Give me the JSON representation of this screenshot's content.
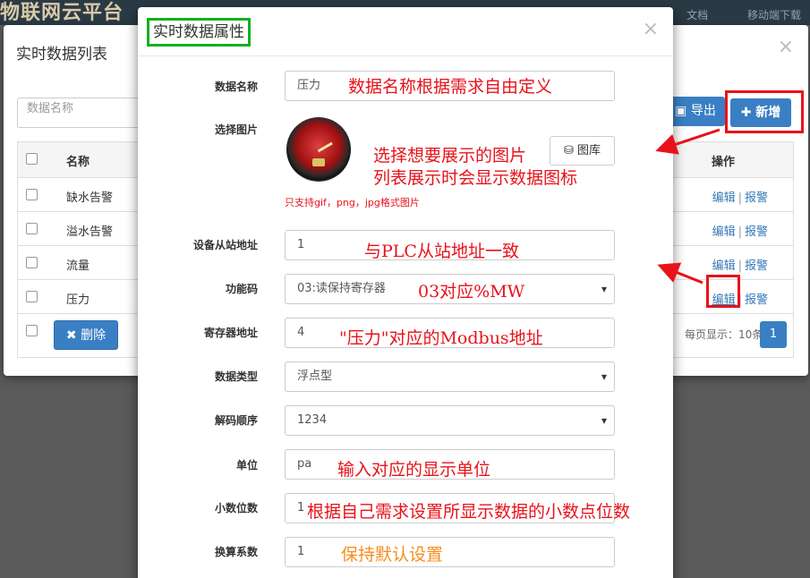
{
  "topbar": {
    "brand": "物联网云平台",
    "link_docs": "文档",
    "link_mobile": "移动端下载"
  },
  "list_modal": {
    "title": "实时数据列表",
    "close": "×",
    "search_placeholder": "数据名称",
    "export_label": "导出",
    "new_label": "新增",
    "columns": {
      "name": "名称",
      "ops": "操作"
    },
    "rows": [
      {
        "name": "缺水告警",
        "edit": "编辑",
        "alarm": "报警"
      },
      {
        "name": "溢水告警",
        "edit": "编辑",
        "alarm": "报警"
      },
      {
        "name": "流量",
        "edit": "编辑",
        "alarm": "报警"
      },
      {
        "name": "压力",
        "edit": "编辑",
        "alarm": "报警"
      }
    ],
    "delete_label": "删除",
    "pager_text": "每页显示：10条",
    "page_num": "1"
  },
  "form_modal": {
    "title": "实时数据属性",
    "close": "×",
    "fields": {
      "name": {
        "label": "数据名称",
        "value": "压力",
        "annotation": "数据名称根据需求自由定义"
      },
      "image": {
        "label": "选择图片",
        "gallery": "图库",
        "hint": "只支持gif，png，jpg格式图片",
        "annotation_1": "选择想要展示的图片",
        "annotation_2": "列表展示时会显示数据图标"
      },
      "slave": {
        "label": "设备从站地址",
        "value": "1",
        "annotation": "与PLC从站地址一致"
      },
      "func": {
        "label": "功能码",
        "value": "03:读保持寄存器",
        "annotation": "03对应%MW"
      },
      "reg": {
        "label": "寄存器地址",
        "value": "4",
        "annotation": "\"压力\"对应的Modbus地址"
      },
      "dtype": {
        "label": "数据类型",
        "value": "浮点型"
      },
      "order": {
        "label": "解码顺序",
        "value": "1234"
      },
      "unit": {
        "label": "单位",
        "value": "pa",
        "annotation": "输入对应的显示单位"
      },
      "decimals": {
        "label": "小数位数",
        "value": "1",
        "annotation": "根据自己需求设置所显示数据的小数点位数"
      },
      "factor": {
        "label": "换算系数",
        "value": "1",
        "annotation": "保持默认设置"
      }
    }
  },
  "colors": {
    "accent": "#3a7fc4",
    "annotation_red": "#e8121a",
    "annotation_orange": "#f58d1f",
    "title_box": "#14b01e"
  }
}
